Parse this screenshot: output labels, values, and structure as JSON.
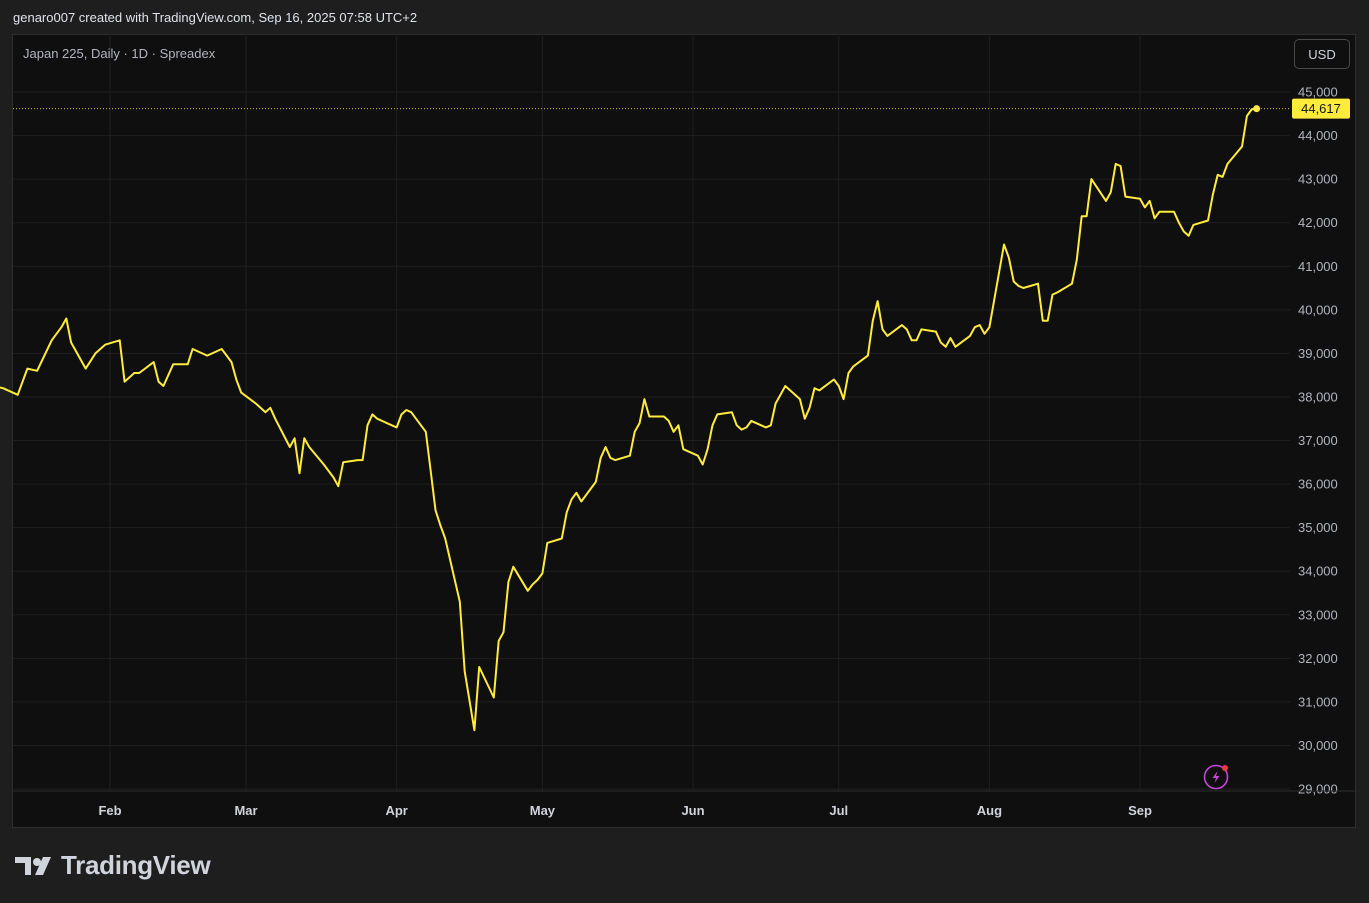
{
  "header": {
    "attribution": "genaro007 created with TradingView.com, Sep 16, 2025 07:58 UTC+2"
  },
  "chart_label": "Japan 225, Daily · 1D · Spreadex",
  "currency_button": "USD",
  "brand": {
    "name": "TradingView"
  },
  "colors": {
    "line": "#ffeb3b",
    "background": "#0f0f0f",
    "grid": "#1f1f1f",
    "price_tag": "#ffeb3b",
    "alert_icon": "#c547d6",
    "alert_dot": "#f23645"
  },
  "icons": {
    "alert": "lightning-alert-icon",
    "logo": "tradingview-logo-icon"
  },
  "chart_data": {
    "type": "line",
    "title": "Japan 225, Daily · 1D · Spreadex",
    "xlabel": "",
    "ylabel": "",
    "ylim": [
      29000,
      45000
    ],
    "y_ticks": [
      "45,000",
      "44,000",
      "43,000",
      "42,000",
      "41,000",
      "40,000",
      "39,000",
      "38,000",
      "37,000",
      "36,000",
      "35,000",
      "34,000",
      "33,000",
      "32,000",
      "31,000",
      "30,000",
      "29,000"
    ],
    "x_ticks": [
      {
        "label": "Feb",
        "date": "2025-02-01"
      },
      {
        "label": "Mar",
        "date": "2025-03-01"
      },
      {
        "label": "Apr",
        "date": "2025-04-01"
      },
      {
        "label": "May",
        "date": "2025-05-01"
      },
      {
        "label": "Jun",
        "date": "2025-06-01"
      },
      {
        "label": "Jul",
        "date": "2025-07-01"
      },
      {
        "label": "Aug",
        "date": "2025-08-01"
      },
      {
        "label": "Sep",
        "date": "2025-09-01"
      }
    ],
    "last_price": 44617,
    "last_price_label": "44,617",
    "grid": true,
    "series": [
      {
        "points": [
          [
            "2025-01-08",
            38250
          ],
          [
            "2025-01-10",
            38200
          ],
          [
            "2025-01-13",
            38050
          ],
          [
            "2025-01-15",
            38650
          ],
          [
            "2025-01-17",
            38600
          ],
          [
            "2025-01-20",
            39300
          ],
          [
            "2025-01-22",
            39600
          ],
          [
            "2025-01-23",
            39800
          ],
          [
            "2025-01-24",
            39250
          ],
          [
            "2025-01-27",
            38650
          ],
          [
            "2025-01-29",
            39000
          ],
          [
            "2025-01-31",
            39200
          ],
          [
            "2025-02-03",
            39300
          ],
          [
            "2025-02-04",
            38350
          ],
          [
            "2025-02-06",
            38550
          ],
          [
            "2025-02-07",
            38550
          ],
          [
            "2025-02-10",
            38800
          ],
          [
            "2025-02-11",
            38350
          ],
          [
            "2025-02-12",
            38250
          ],
          [
            "2025-02-14",
            38750
          ],
          [
            "2025-02-17",
            38750
          ],
          [
            "2025-02-18",
            39100
          ],
          [
            "2025-02-20",
            39000
          ],
          [
            "2025-02-21",
            38950
          ],
          [
            "2025-02-24",
            39100
          ],
          [
            "2025-02-26",
            38800
          ],
          [
            "2025-02-27",
            38400
          ],
          [
            "2025-02-28",
            38100
          ],
          [
            "2025-03-03",
            37850
          ],
          [
            "2025-03-05",
            37650
          ],
          [
            "2025-03-06",
            37750
          ],
          [
            "2025-03-07",
            37500
          ],
          [
            "2025-03-10",
            36850
          ],
          [
            "2025-03-11",
            37050
          ],
          [
            "2025-03-12",
            36250
          ],
          [
            "2025-03-13",
            37050
          ],
          [
            "2025-03-14",
            36850
          ],
          [
            "2025-03-17",
            36450
          ],
          [
            "2025-03-19",
            36150
          ],
          [
            "2025-03-20",
            35950
          ],
          [
            "2025-03-21",
            36500
          ],
          [
            "2025-03-24",
            36550
          ],
          [
            "2025-03-25",
            36550
          ],
          [
            "2025-03-26",
            37350
          ],
          [
            "2025-03-27",
            37600
          ],
          [
            "2025-03-28",
            37500
          ],
          [
            "2025-03-31",
            37350
          ],
          [
            "2025-04-01",
            37300
          ],
          [
            "2025-04-02",
            37600
          ],
          [
            "2025-04-03",
            37700
          ],
          [
            "2025-04-04",
            37650
          ],
          [
            "2025-04-07",
            37200
          ],
          [
            "2025-04-08",
            36300
          ],
          [
            "2025-04-09",
            35400
          ],
          [
            "2025-04-10",
            35050
          ],
          [
            "2025-04-11",
            34750
          ],
          [
            "2025-04-14",
            33300
          ],
          [
            "2025-04-15",
            31700
          ],
          [
            "2025-04-17",
            30350
          ],
          [
            "2025-04-18",
            31800
          ],
          [
            "2025-04-21",
            31100
          ],
          [
            "2025-04-22",
            32400
          ],
          [
            "2025-04-23",
            32600
          ],
          [
            "2025-04-24",
            33750
          ],
          [
            "2025-04-25",
            34100
          ],
          [
            "2025-04-28",
            33550
          ],
          [
            "2025-04-29",
            33700
          ],
          [
            "2025-04-30",
            33800
          ],
          [
            "2025-05-01",
            33950
          ],
          [
            "2025-05-02",
            34650
          ],
          [
            "2025-05-05",
            34750
          ],
          [
            "2025-05-06",
            35350
          ],
          [
            "2025-05-07",
            35650
          ],
          [
            "2025-05-08",
            35800
          ],
          [
            "2025-05-09",
            35600
          ],
          [
            "2025-05-12",
            36050
          ],
          [
            "2025-05-13",
            36600
          ],
          [
            "2025-05-14",
            36850
          ],
          [
            "2025-05-15",
            36600
          ],
          [
            "2025-05-16",
            36550
          ],
          [
            "2025-05-19",
            36650
          ],
          [
            "2025-05-20",
            37200
          ],
          [
            "2025-05-21",
            37400
          ],
          [
            "2025-05-22",
            37950
          ],
          [
            "2025-05-23",
            37550
          ],
          [
            "2025-05-26",
            37550
          ],
          [
            "2025-05-27",
            37450
          ],
          [
            "2025-05-28",
            37200
          ],
          [
            "2025-05-29",
            37350
          ],
          [
            "2025-05-30",
            36800
          ],
          [
            "2025-06-02",
            36650
          ],
          [
            "2025-06-03",
            36450
          ],
          [
            "2025-06-04",
            36800
          ],
          [
            "2025-06-05",
            37350
          ],
          [
            "2025-06-06",
            37600
          ],
          [
            "2025-06-09",
            37650
          ],
          [
            "2025-06-10",
            37350
          ],
          [
            "2025-06-11",
            37250
          ],
          [
            "2025-06-12",
            37300
          ],
          [
            "2025-06-13",
            37450
          ],
          [
            "2025-06-16",
            37300
          ],
          [
            "2025-06-17",
            37350
          ],
          [
            "2025-06-18",
            37850
          ],
          [
            "2025-06-19",
            38050
          ],
          [
            "2025-06-20",
            38250
          ],
          [
            "2025-06-23",
            37950
          ],
          [
            "2025-06-24",
            37500
          ],
          [
            "2025-06-25",
            37750
          ],
          [
            "2025-06-26",
            38200
          ],
          [
            "2025-06-27",
            38150
          ],
          [
            "2025-06-30",
            38400
          ],
          [
            "2025-07-01",
            38250
          ],
          [
            "2025-07-02",
            37950
          ],
          [
            "2025-07-03",
            38550
          ],
          [
            "2025-07-04",
            38700
          ],
          [
            "2025-07-07",
            38950
          ],
          [
            "2025-07-08",
            39750
          ],
          [
            "2025-07-09",
            40200
          ],
          [
            "2025-07-10",
            39550
          ],
          [
            "2025-07-11",
            39400
          ],
          [
            "2025-07-14",
            39650
          ],
          [
            "2025-07-15",
            39550
          ],
          [
            "2025-07-16",
            39300
          ],
          [
            "2025-07-17",
            39300
          ],
          [
            "2025-07-18",
            39550
          ],
          [
            "2025-07-21",
            39500
          ],
          [
            "2025-07-22",
            39250
          ],
          [
            "2025-07-23",
            39150
          ],
          [
            "2025-07-24",
            39350
          ],
          [
            "2025-07-25",
            39150
          ],
          [
            "2025-07-28",
            39400
          ],
          [
            "2025-07-29",
            39600
          ],
          [
            "2025-07-30",
            39650
          ],
          [
            "2025-07-31",
            39450
          ],
          [
            "2025-08-01",
            39600
          ],
          [
            "2025-08-04",
            41500
          ],
          [
            "2025-08-05",
            41200
          ],
          [
            "2025-08-06",
            40650
          ],
          [
            "2025-08-07",
            40550
          ],
          [
            "2025-08-08",
            40500
          ],
          [
            "2025-08-11",
            40600
          ],
          [
            "2025-08-12",
            39750
          ],
          [
            "2025-08-13",
            39750
          ],
          [
            "2025-08-14",
            40350
          ],
          [
            "2025-08-15",
            40400
          ],
          [
            "2025-08-18",
            40600
          ],
          [
            "2025-08-19",
            41150
          ],
          [
            "2025-08-20",
            42150
          ],
          [
            "2025-08-21",
            42150
          ],
          [
            "2025-08-22",
            43000
          ],
          [
            "2025-08-25",
            42500
          ],
          [
            "2025-08-26",
            42700
          ],
          [
            "2025-08-27",
            43350
          ],
          [
            "2025-08-28",
            43300
          ],
          [
            "2025-08-29",
            42600
          ],
          [
            "2025-09-01",
            42550
          ],
          [
            "2025-09-02",
            42350
          ],
          [
            "2025-09-03",
            42500
          ],
          [
            "2025-09-04",
            42100
          ],
          [
            "2025-09-05",
            42250
          ],
          [
            "2025-09-08",
            42250
          ],
          [
            "2025-09-09",
            42000
          ],
          [
            "2025-09-10",
            41800
          ],
          [
            "2025-09-11",
            41700
          ],
          [
            "2025-09-12",
            41950
          ],
          [
            "2025-09-15",
            42050
          ],
          [
            "2025-09-16",
            42650
          ],
          [
            "2025-09-17",
            43100
          ],
          [
            "2025-09-18",
            43050
          ],
          [
            "2025-09-19",
            43350
          ],
          [
            "2025-09-22",
            43750
          ],
          [
            "2025-09-23",
            44450
          ],
          [
            "2025-09-24",
            44600
          ],
          [
            "2025-09-25",
            44617
          ]
        ]
      }
    ]
  }
}
